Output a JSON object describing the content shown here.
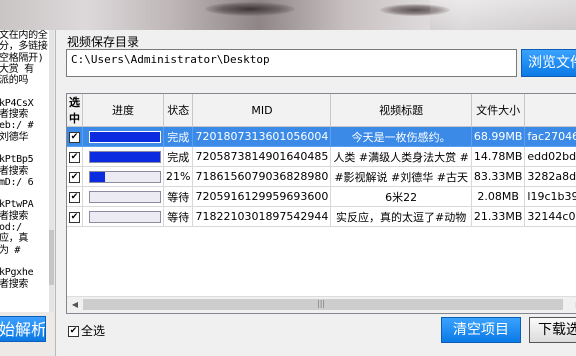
{
  "left_panel": {
    "lines": [
      "文在内的全",
      "分，多链接",
      "空格隔开)",
      "大赏 有",
      "派的吗",
      "",
      "kP4CsX",
      "者搜索",
      "eb:/ #",
      "刘德华",
      "",
      "kPtBp5",
      "者搜索",
      "mD:/ 6",
      "",
      "kPtwPA",
      "者搜索",
      "od:/",
      "应，真",
      "为 #",
      "",
      "kPgxhe",
      "者搜索"
    ],
    "parse_button": "始解析"
  },
  "directory": {
    "label": "视频保存目录",
    "path": "C:\\Users\\Administrator\\Desktop",
    "browse_button": "浏览文件"
  },
  "table": {
    "columns": [
      "选中",
      "进度",
      "状态",
      "MID",
      "视频标题",
      "文件大小",
      ""
    ],
    "rows": [
      {
        "checked": "✔",
        "progress": 1.0,
        "status": "完成",
        "mid": "7201807313601056004",
        "title": "今天是一枚伤感约。",
        "size": "68.99MB",
        "extra": "fac27046ab",
        "selected": true
      },
      {
        "checked": "✔",
        "progress": 1.0,
        "status": "完成",
        "mid": "7205873814901640485",
        "title": "人类 #满级人类身法大赏 #",
        "size": "14.78MB",
        "extra": "edd02bd82l",
        "selected": false
      },
      {
        "checked": "✔",
        "progress": 0.21,
        "status": "21%",
        "mid": "7186156079036828980",
        "title": "#影视解说 #刘德华 #古天",
        "size": "83.33MB",
        "extra": "3282a8da39",
        "selected": false
      },
      {
        "checked": "✔",
        "progress": 0,
        "status": "等待",
        "mid": "7205916129959693600",
        "title": "6米22",
        "size": "2.08MB",
        "extra": "l19c1b394b",
        "selected": false
      },
      {
        "checked": "✔",
        "progress": 0,
        "status": "等待",
        "mid": "7182210301897542944",
        "title": "实反应，真的太逗了#动物",
        "size": "21.33MB",
        "extra": "32144c0d27",
        "selected": false
      }
    ]
  },
  "bottom": {
    "select_all_label": "全选",
    "select_all_check": "✔",
    "clear_button": "清空项目",
    "download_button": "下载选"
  },
  "colors": {
    "accent_button": "#1a8cf0",
    "selection": "#3b8ae8",
    "progress_fill": "#0a2be0"
  }
}
